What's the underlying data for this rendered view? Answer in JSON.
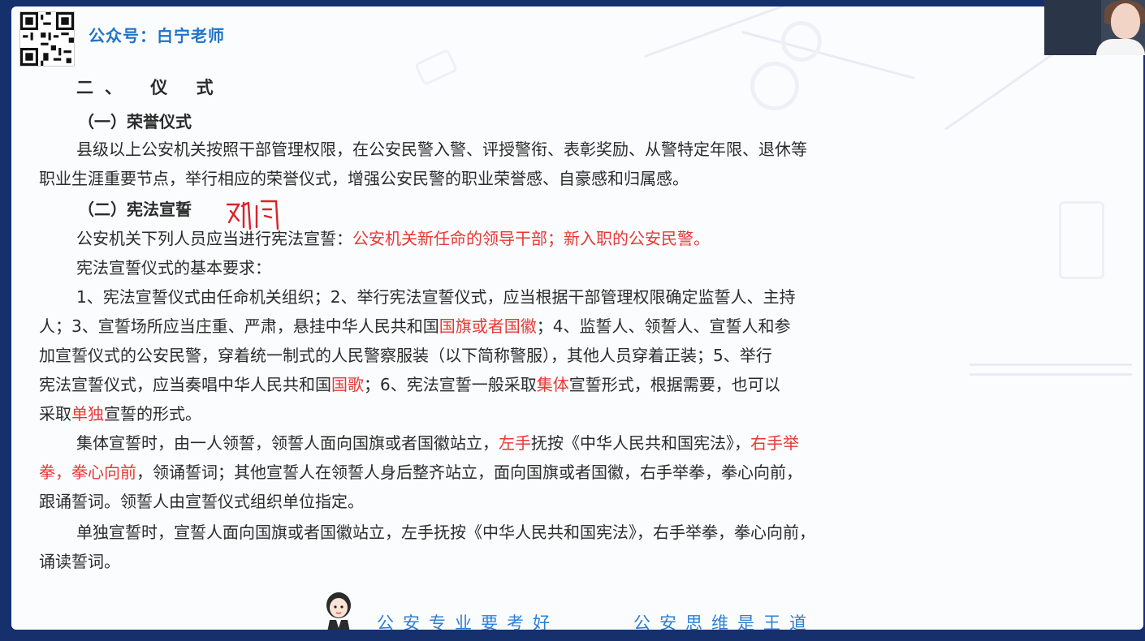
{
  "header": {
    "brand": "公众号：白宁老师"
  },
  "section": {
    "title": "二、 仪 式",
    "sub1": {
      "title": "（一）荣誉仪式",
      "lines": [
        "县级以上公安机关按照干部管理权限，在公安民警入警、评授警衔、表彰奖励、从警特定年限、退休等",
        "职业生涯重要节点，举行相应的荣誉仪式，增强公安民警的职业荣誉感、自豪感和归属感。"
      ]
    },
    "sub2": {
      "title": "（二）宪法宣誓",
      "handwritten": "对门",
      "persons_intro": "公安机关下列人员应当进行宪法宣誓：",
      "persons_red": "公安机关新任命的领导干部；新入职的公安民警。",
      "req_title": "宪法宣誓仪式的基本要求：",
      "req_l1": "1、宪法宣誓仪式由任命机关组织；2、举行宪法宣誓仪式，应当根据干部管理权限确定监誓人、主持",
      "req_l2a": "人；3、宣誓场所应当庄重、严肃，悬挂中华人民共和国",
      "req_l2r": "国旗或者国徽",
      "req_l2b": "；4、监誓人、领誓人、宣誓人和参",
      "req_l3": "加宣誓仪式的公安民警，穿着统一制式的人民警察服装（以下简称警服），其他人员穿着正装；5、举行",
      "req_l4a": "宪法宣誓仪式，应当奏唱中华人民共和国",
      "req_l4r1": "国歌",
      "req_l4b": "；6、宪法宣誓一般采取",
      "req_l4r2": "集体",
      "req_l4c": "宣誓形式，根据需要，也可以",
      "req_l5a": "采取",
      "req_l5r": "单独",
      "req_l5b": "宣誓的形式。",
      "grp_l1a": "集体宣誓时，由一人领誓，领誓人面向国旗或者国徽站立，",
      "grp_l1r1": "左手",
      "grp_l1b": "抚按《中华人民共和国宪法》，",
      "grp_l1r2": "右手举",
      "grp_l2r": "拳，拳心向前",
      "grp_l2b": "，领诵誓词；其他宣誓人在领誓人身后整齐站立，面向国旗或者国徽，右手举拳，拳心向前，",
      "grp_l3": "跟诵誓词。领誓人由宣誓仪式组织单位指定。",
      "ind_l1": "单独宣誓时，宣誓人面向国旗或者国徽站立，左手抚按《中华人民共和国宪法》，右手举拳，拳心向前，",
      "ind_l2": "诵读誓词。"
    }
  },
  "footer": {
    "slogan_left": "公安专业要考好",
    "slogan_right": "公安思维是王道"
  },
  "colors": {
    "highlight": "#e53935",
    "brand": "#1e73c8",
    "slogan": "#2d7fd4",
    "frame": "#16306e"
  }
}
